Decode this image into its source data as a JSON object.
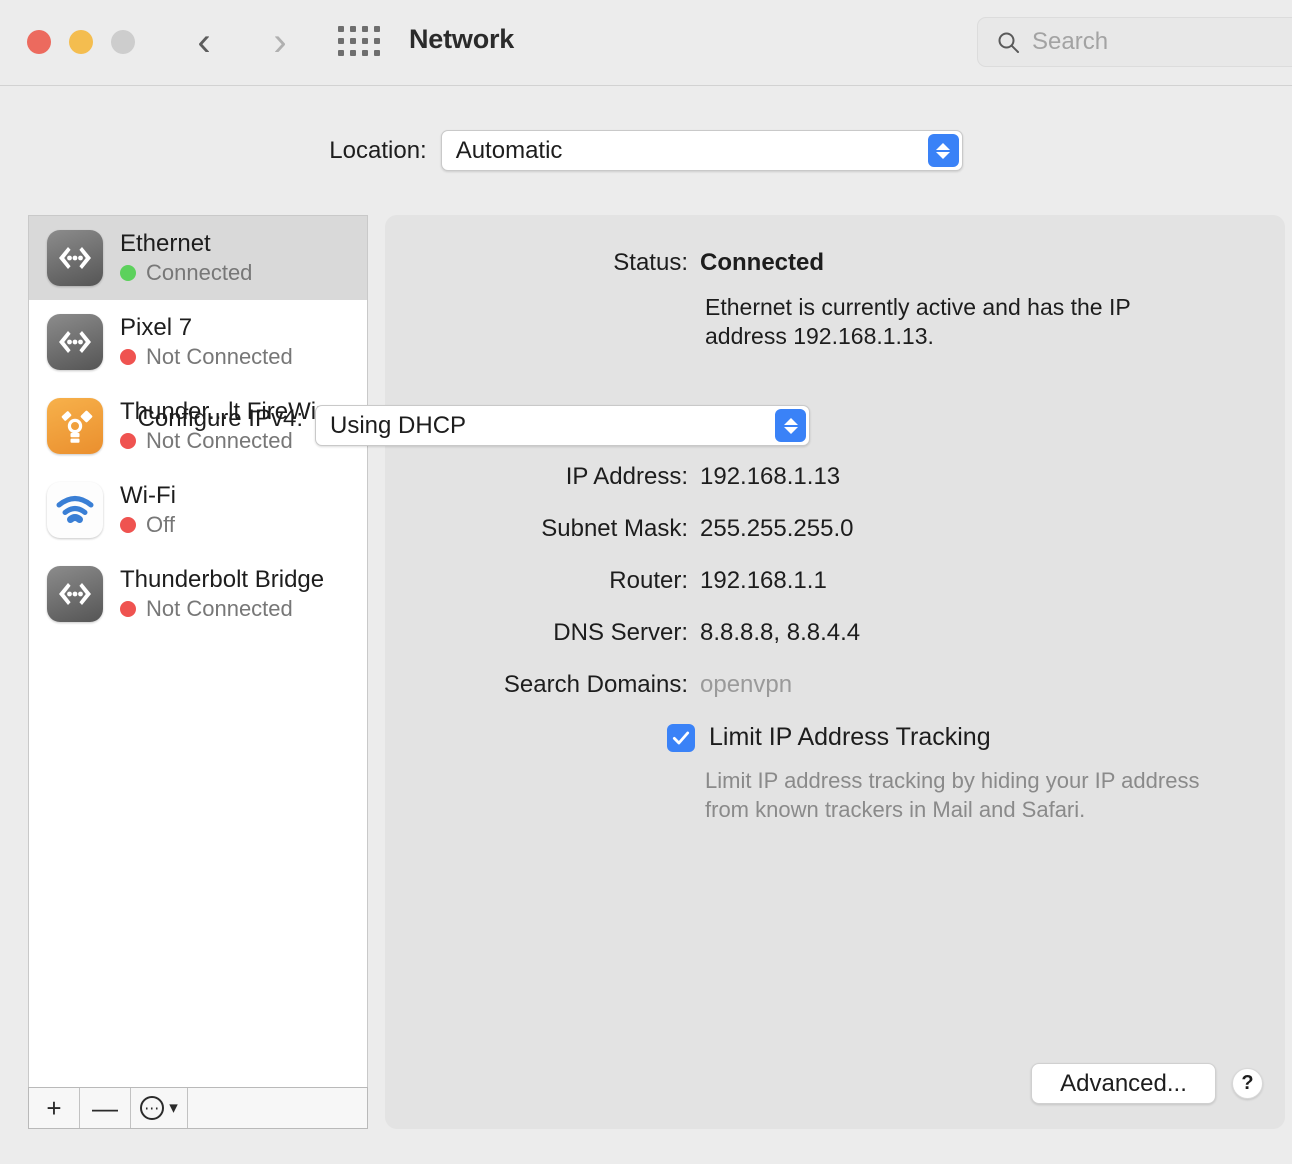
{
  "window": {
    "title": "Network",
    "traffic_lights": [
      "close",
      "minimize",
      "zoom"
    ],
    "colors": {
      "close": "#ec6a5e",
      "minimize": "#f4bd4f",
      "zoom": "#cdcdcd",
      "accent": "#3a82f7"
    }
  },
  "search": {
    "placeholder": "Search",
    "value": ""
  },
  "location": {
    "label": "Location:",
    "value": "Automatic"
  },
  "services": [
    {
      "name": "Ethernet",
      "status": "Connected",
      "status_color": "green",
      "icon": "ethernet-icon",
      "selected": true
    },
    {
      "name": "Pixel 7",
      "status": "Not Connected",
      "status_color": "red",
      "icon": "ethernet-icon",
      "selected": false
    },
    {
      "name": "Thunder...lt FireWire",
      "status": "Not Connected",
      "status_color": "red",
      "icon": "firewire-icon",
      "selected": false
    },
    {
      "name": "Wi-Fi",
      "status": "Off",
      "status_color": "red",
      "icon": "wifi-icon",
      "selected": false
    },
    {
      "name": "Thunderbolt Bridge",
      "status": "Not Connected",
      "status_color": "red",
      "icon": "ethernet-icon",
      "selected": false
    }
  ],
  "sidebar_toolbar": {
    "add": "+",
    "remove": "—",
    "actions": "⋯"
  },
  "detail": {
    "status_label": "Status:",
    "status_value": "Connected",
    "status_description": "Ethernet is currently active and has the IP address 192.168.1.13.",
    "configure_ipv4_label": "Configure IPv4:",
    "configure_ipv4_value": "Using DHCP",
    "ip_address_label": "IP Address:",
    "ip_address_value": "192.168.1.13",
    "subnet_mask_label": "Subnet Mask:",
    "subnet_mask_value": "255.255.255.0",
    "router_label": "Router:",
    "router_value": "192.168.1.1",
    "dns_server_label": "DNS Server:",
    "dns_server_value": "8.8.8.8, 8.8.4.4",
    "search_domains_label": "Search Domains:",
    "search_domains_value": "openvpn",
    "limit_tracking_label": "Limit IP Address Tracking",
    "limit_tracking_checked": true,
    "limit_tracking_description": "Limit IP address tracking by hiding your IP address from known trackers in Mail and Safari.",
    "advanced_button": "Advanced...",
    "help_button": "?"
  }
}
